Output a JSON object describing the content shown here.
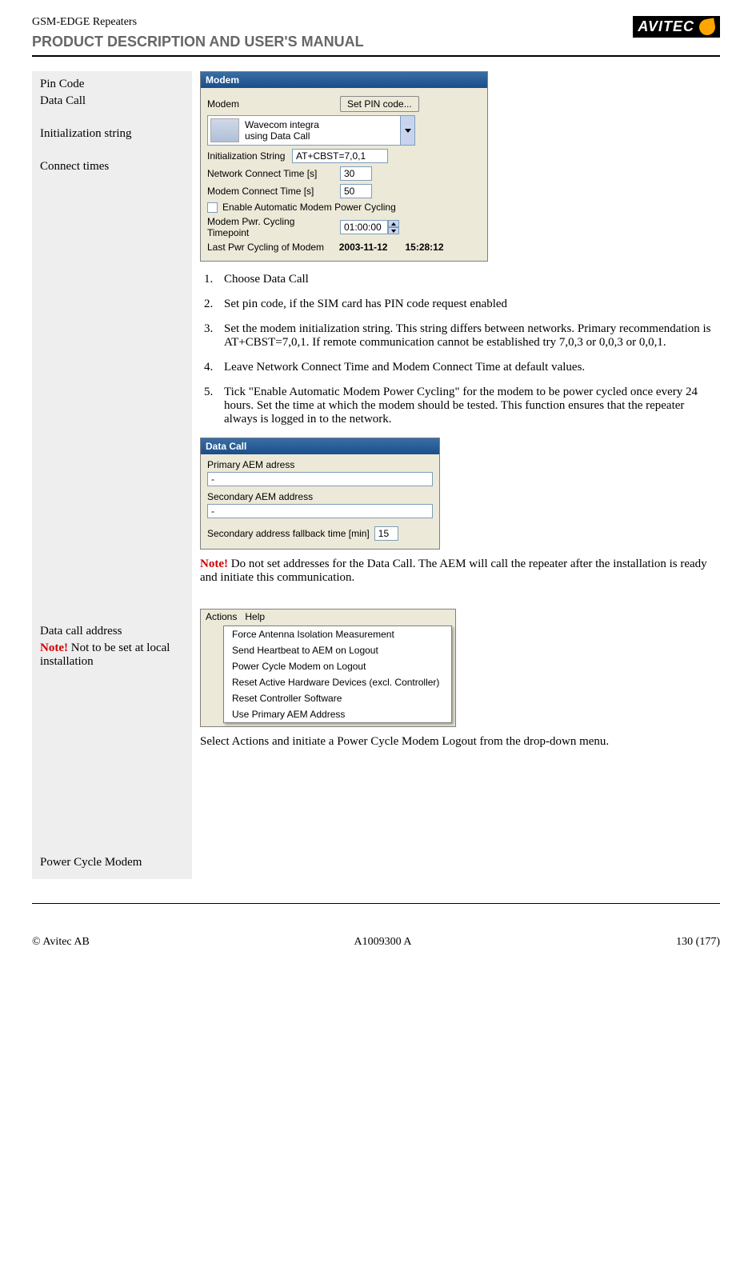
{
  "header": {
    "product_line": "GSM-EDGE Repeaters",
    "subtitle": "PRODUCT DESCRIPTION AND USER'S MANUAL",
    "logo_text": "AVITEC"
  },
  "labels": {
    "pin_code": "Pin Code",
    "data_call": "Data Call",
    "init_string": "Initialization string",
    "connect_times": "Connect times",
    "data_call_address": "Data call address",
    "note_prefix": "Note!",
    "note_local": " Not to be set at local installation",
    "power_cycle_modem": "Power Cycle Modem"
  },
  "modem_panel": {
    "title": "Modem",
    "modem_label": "Modem",
    "set_pin_btn": "Set PIN code...",
    "device_line1": "Wavecom integra",
    "device_line2": "using Data Call",
    "init_label": "Initialization String",
    "init_value": "AT+CBST=7,0,1",
    "net_time_label": "Network Connect Time [s]",
    "net_time_value": "30",
    "modem_time_label": "Modem Connect Time [s]",
    "modem_time_value": "50",
    "enable_cycle_label": "Enable Automatic Modem Power Cycling",
    "timepoint_label": "Modem Pwr. Cycling Timepoint",
    "timepoint_value": "01:00:00",
    "last_cycle_label": "Last Pwr Cycling of Modem",
    "last_cycle_date": "2003-11-12",
    "last_cycle_time": "15:28:12"
  },
  "steps": {
    "s1": "Choose Data Call",
    "s2": "Set pin code, if the SIM card has PIN code request enabled",
    "s3": "Set the modem initialization string. This string differs between networks. Primary recommendation is AT+CBST=7,0,1. If remote communication cannot be established try 7,0,3 or 0,0,3 or 0,0,1.",
    "s4": "Leave Network Connect Time and Modem Connect Time at default values.",
    "s5": "Tick \"Enable Automatic Modem Power Cycling\" for the modem to be power cycled once every 24 hours. Set the time at which the modem should be tested. This function ensures that the repeater always is logged in to the network."
  },
  "data_call_panel": {
    "title": "Data Call",
    "primary_label": "Primary AEM adress",
    "primary_value": "-",
    "secondary_label": "Secondary AEM address",
    "secondary_value": "-",
    "fallback_label": "Secondary address fallback time [min]",
    "fallback_value": "15"
  },
  "notes": {
    "do_not_set": " Do not set addresses for the Data Call. The AEM will call the repeater after the installation is ready and initiate this communication."
  },
  "actions_menu": {
    "actions_label": "Actions",
    "help_label": "Help",
    "item1": "Force Antenna Isolation Measurement",
    "item2": "Send Heartbeat to AEM on Logout",
    "item3": "Power Cycle Modem on Logout",
    "item4": "Reset Active Hardware Devices (excl. Controller)",
    "item5": "Reset Controller Software",
    "item6": "Use Primary AEM Address"
  },
  "closing": "Select Actions and initiate a Power Cycle Modem Logout from the drop-down menu.",
  "footer": {
    "left": "© Avitec AB",
    "center": "A1009300 A",
    "right": "130 (177)"
  }
}
